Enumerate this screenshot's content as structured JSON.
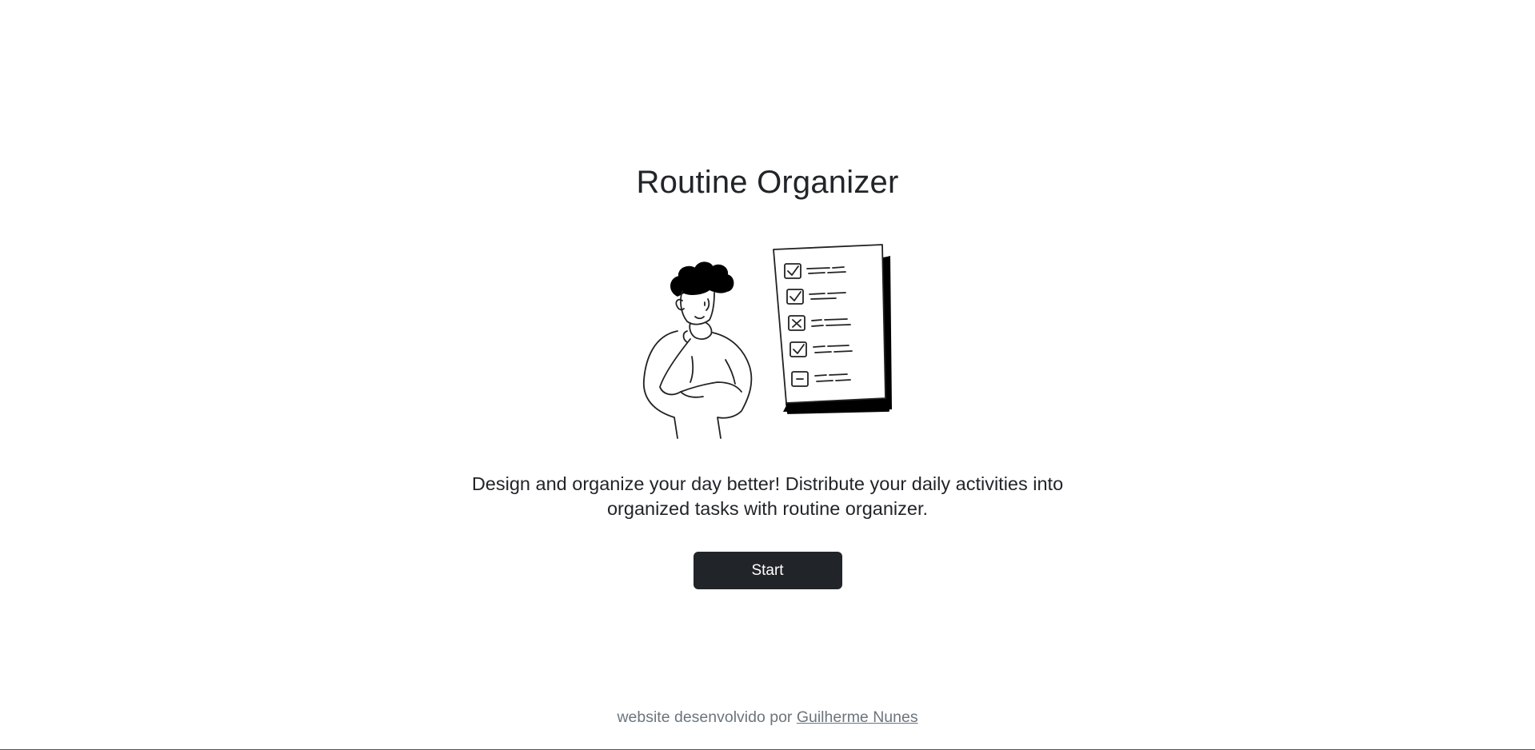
{
  "app": {
    "title": "Routine Organizer"
  },
  "hero": {
    "illustration_icon": "thinking-person-with-checklist-illustration",
    "description": "Design and organize your day better! Distribute your daily activities into organized tasks with routine organizer.",
    "start_label": "Start"
  },
  "footer": {
    "credit_text": "website desenvolvido por ",
    "author_link": "Guilherme Nunes"
  },
  "colors": {
    "text": "#212529",
    "button_bg": "#212529",
    "button_text": "#ffffff",
    "footer_text": "#6c757d",
    "background": "#ffffff"
  }
}
